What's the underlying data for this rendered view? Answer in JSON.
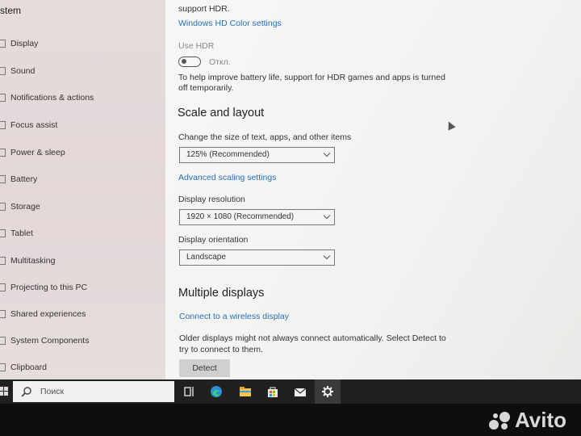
{
  "sidebar": {
    "title": "stem",
    "items": [
      {
        "label": "Display"
      },
      {
        "label": "Sound"
      },
      {
        "label": "Notifications & actions"
      },
      {
        "label": "Focus assist"
      },
      {
        "label": "Power & sleep"
      },
      {
        "label": "Battery"
      },
      {
        "label": "Storage"
      },
      {
        "label": "Tablet"
      },
      {
        "label": "Multitasking"
      },
      {
        "label": "Projecting to this PC"
      },
      {
        "label": "Shared experiences"
      },
      {
        "label": "System Components"
      },
      {
        "label": "Clipboard"
      }
    ]
  },
  "main": {
    "hdr_tail": "support HDR.",
    "hd_color_link": "Windows HD Color settings",
    "use_hdr_label": "Use HDR",
    "use_hdr_state": "Откл.",
    "hdr_desc_1": "To help improve battery life, support for HDR games and apps is turned",
    "hdr_desc_2": "off temporarily.",
    "scale_heading": "Scale and layout",
    "scale_label": "Change the size of text, apps, and other items",
    "scale_value": "125% (Recommended)",
    "advanced_link": "Advanced scaling settings",
    "resolution_label": "Display resolution",
    "resolution_value": "1920 × 1080 (Recommended)",
    "orientation_label": "Display orientation",
    "orientation_value": "Landscape",
    "multi_heading": "Multiple displays",
    "wireless_link": "Connect to a wireless display",
    "older_desc_1": "Older displays might not always connect automatically. Select Detect to",
    "older_desc_2": "try to connect to them.",
    "detect_button": "Detect"
  },
  "taskbar": {
    "search_placeholder": "Поиск",
    "icons": [
      "task-view-icon",
      "edge-icon",
      "file-explorer-icon",
      "store-icon",
      "mail-icon",
      "settings-icon"
    ]
  },
  "watermark": {
    "text": "Avito"
  }
}
